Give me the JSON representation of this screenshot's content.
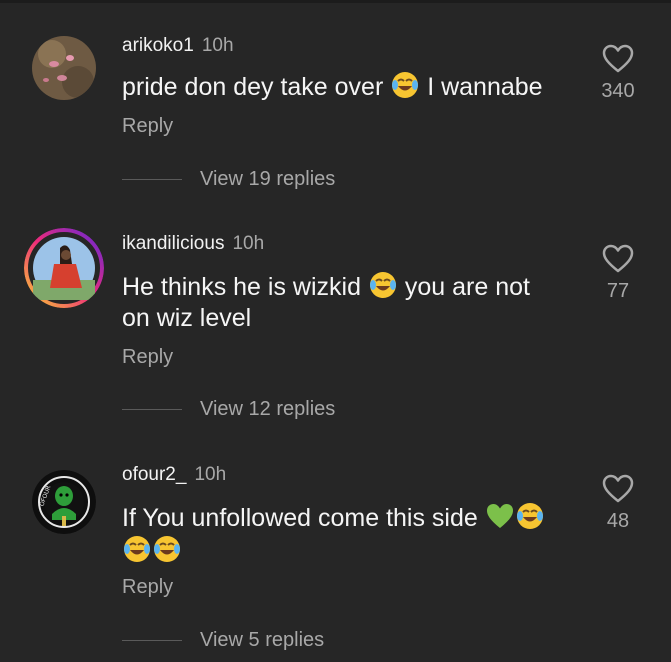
{
  "comments": [
    {
      "username": "arikoko1",
      "time": "10h",
      "text_parts": [
        "pride don dey take over",
        "I wannabe"
      ],
      "emojis": [
        "face-with-tears-of-joy-icon"
      ],
      "reply_label": "Reply",
      "view_replies": "View 19 replies",
      "likes": "340"
    },
    {
      "username": "ikandilicious",
      "time": "10h",
      "text_parts": [
        "He thinks he is wizkid",
        "you are not",
        "on wiz level"
      ],
      "emojis": [
        "face-with-tears-of-joy-icon"
      ],
      "reply_label": "Reply",
      "view_replies": "View 12 replies",
      "likes": "77"
    },
    {
      "username": "ofour2_",
      "time": "10h",
      "text_parts": [
        "If You unfollowed come this side"
      ],
      "emojis": [
        "green-heart-icon",
        "face-with-tears-of-joy-icon",
        "face-with-tears-of-joy-icon",
        "face-with-tears-of-joy-icon"
      ],
      "reply_label": "Reply",
      "view_replies": "View 5 replies",
      "likes": "48"
    }
  ],
  "colors": {
    "background": "#262626",
    "primary_text": "#f5f5f5",
    "secondary_text": "#a8a8a8",
    "story_ring_start": "#f9ce34",
    "story_ring_end": "#ee2a7b"
  }
}
